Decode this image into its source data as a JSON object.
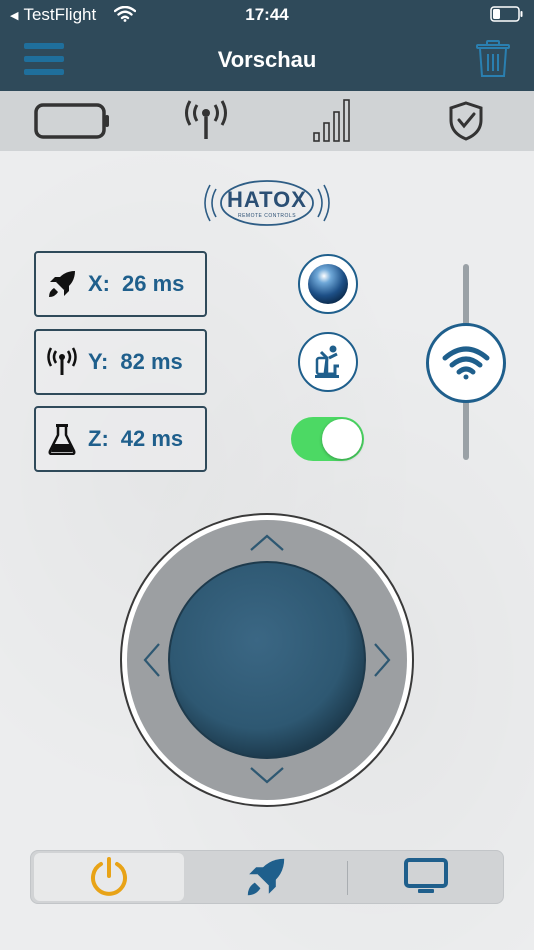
{
  "status_bar": {
    "back_app": "TestFlight",
    "time": "17:44"
  },
  "navbar": {
    "title": "Vorschau"
  },
  "icon_bar": {
    "icons": [
      "battery-icon",
      "antenna-icon",
      "signal-strength-icon",
      "shield-check-icon"
    ]
  },
  "logo": {
    "brand": "HATOX",
    "tagline": "REMOTE CONTROLS"
  },
  "metrics": [
    {
      "icon": "rocket-icon",
      "label": "X:",
      "value": "26 ms"
    },
    {
      "icon": "antenna-icon",
      "label": "Y:",
      "value": "82 ms"
    },
    {
      "icon": "flask-icon",
      "label": "Z:",
      "value": "42 ms"
    }
  ],
  "controls": {
    "toggle_on": true
  },
  "tab_bar": {
    "tabs": [
      "power-icon",
      "rocket-icon",
      "monitor-icon"
    ],
    "active_index": 0
  },
  "colors": {
    "header": "#2f4a5a",
    "accent_blue": "#1f5f8c",
    "power_orange": "#e8a317",
    "toggle_green": "#4cd964",
    "joystick": "#2e5872"
  }
}
